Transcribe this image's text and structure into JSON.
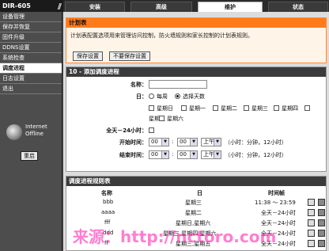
{
  "header": {
    "logo_text": "DIR-605",
    "tabs": [
      {
        "label": "安装"
      },
      {
        "label": "高级"
      },
      {
        "label": "维护"
      },
      {
        "label": "状态"
      }
    ]
  },
  "sidebar": {
    "items": [
      {
        "label": "设备管理"
      },
      {
        "label": "保存并恢复"
      },
      {
        "label": "固件升级"
      },
      {
        "label": "DDNS设置"
      },
      {
        "label": "系统检查"
      },
      {
        "label": "调度进程"
      },
      {
        "label": "日志设置"
      },
      {
        "label": "退出"
      }
    ],
    "status_line1": "Internet",
    "status_line2": "Offline",
    "reboot_label": "重启"
  },
  "schedule_intro": {
    "title": "计划表",
    "description": "计划表配置选项用来管理访问控制，防火墙规则和家长控制的计划表规则。",
    "save_label": "保存设置",
    "nosave_label": "不要保存设置"
  },
  "add_schedule": {
    "title": "10 - 添加调度进程",
    "name_label": "名称：",
    "day_label": "日：",
    "weekly_label": "每周",
    "select_days_label": "选择天数",
    "days": [
      "星期日",
      "星期一",
      "星期二",
      "星期三",
      "星期四",
      "星期五",
      "星期六"
    ],
    "allday_label": "全天－24小时：",
    "start_label": "开始时间：",
    "end_label": "结束时间：",
    "hour_value": "00",
    "min_value": "00",
    "ampm_value": "上午",
    "time_hint": "（小时：分钟，12小时）"
  },
  "schedule_list": {
    "title": "调度进程规则表",
    "columns": [
      "名称",
      "日",
      "时间帧"
    ],
    "rows": [
      {
        "name": "bbb",
        "day": "星期三",
        "time": "11:38 ～ 23:59"
      },
      {
        "name": "aaaa",
        "day": "星期二",
        "time": "全天－24小时"
      },
      {
        "name": "fff",
        "day": "星期日,星期六",
        "time": "全天－24小时"
      },
      {
        "name": "ddd",
        "day": "星期三,星期四,星期六",
        "time": "全天－24小时"
      },
      {
        "name": "ff",
        "day": "星期三,星期五",
        "time": "全天－24小时"
      }
    ]
  },
  "watermark": "来源：http://nctoro.com"
}
